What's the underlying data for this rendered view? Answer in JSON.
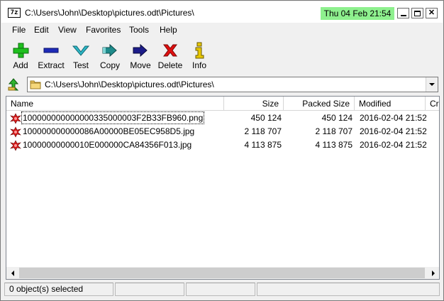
{
  "window": {
    "icon_text": "7z",
    "title": "C:\\Users\\John\\Desktop\\pictures.odt\\Pictures\\",
    "clock": "Thu 04 Feb 21:54",
    "clock_color": "#8ef08e"
  },
  "menu": {
    "items": [
      {
        "label": "File"
      },
      {
        "label": "Edit"
      },
      {
        "label": "View"
      },
      {
        "label": "Favorites"
      },
      {
        "label": "Tools"
      },
      {
        "label": "Help"
      }
    ]
  },
  "toolbar": {
    "items": [
      {
        "label": "Add",
        "icon": "plus-icon",
        "color": "#1fc01f"
      },
      {
        "label": "Extract",
        "icon": "minus-icon",
        "color": "#1e2bb8"
      },
      {
        "label": "Test",
        "icon": "check-icon",
        "color": "#2cb7c7"
      },
      {
        "label": "Copy",
        "icon": "copy-arrow-icon",
        "color": "#1f8c8c"
      },
      {
        "label": "Move",
        "icon": "move-arrow-icon",
        "color": "#1c1c8a"
      },
      {
        "label": "Delete",
        "icon": "delete-x-icon",
        "color": "#e01010"
      },
      {
        "label": "Info",
        "icon": "info-icon",
        "color": "#e8c800"
      }
    ]
  },
  "address": {
    "value": "C:\\Users\\John\\Desktop\\pictures.odt\\Pictures\\"
  },
  "list": {
    "columns": [
      {
        "label": "Name"
      },
      {
        "label": "Size"
      },
      {
        "label": "Packed Size"
      },
      {
        "label": "Modified"
      },
      {
        "label": "Cr"
      }
    ],
    "rows": [
      {
        "name": "100000000000000335000003F2B33FB960.png",
        "size": "450 124",
        "packed": "450 124",
        "modified": "2016-02-04 21:52"
      },
      {
        "name": "100000000000086A00000BE05EC958D5.jpg",
        "size": "2 118 707",
        "packed": "2 118 707",
        "modified": "2016-02-04 21:52"
      },
      {
        "name": "10000000000010E000000CA84356F013.jpg",
        "size": "4 113 875",
        "packed": "4 113 875",
        "modified": "2016-02-04 21:52"
      }
    ]
  },
  "status": {
    "selected": "0 object(s) selected"
  }
}
